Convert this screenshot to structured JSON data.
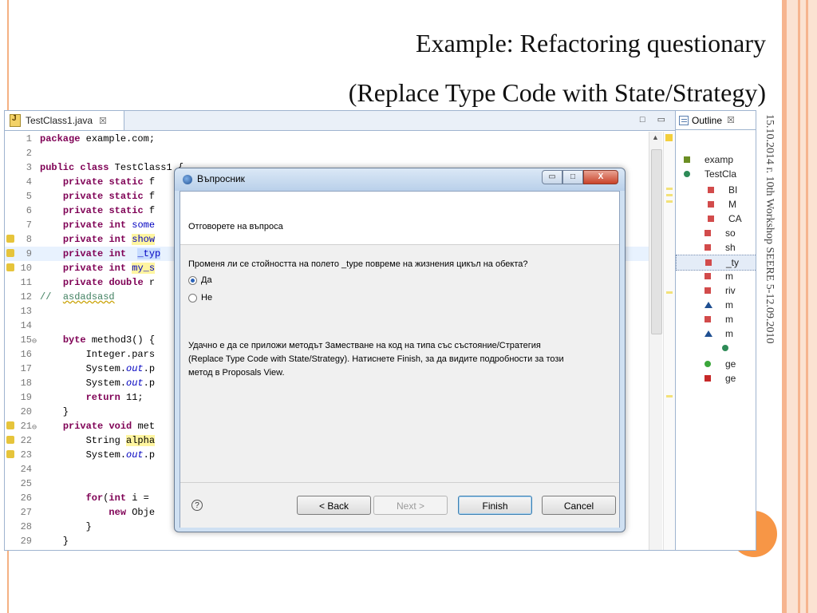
{
  "slide": {
    "title_line1": "Example: Refactoring questionary",
    "title_line2": "(Replace Type Code with State/Strategy)",
    "side_text_date": "15.10.2014 г.",
    "side_text_event": "10th Workshop SEERE 5-12.09.2010",
    "accent_color": "#f79646",
    "band_color": "#fbe2d2"
  },
  "editor": {
    "tab_label": "TestClass1.java",
    "tab_close": "☒",
    "window_controls": "□ ▭",
    "lines": [
      {
        "n": "1",
        "text": "package example.com;"
      },
      {
        "n": "2",
        "text": ""
      },
      {
        "n": "3",
        "text": "public class TestClass1 {"
      },
      {
        "n": "4",
        "text": "    private static f"
      },
      {
        "n": "5",
        "text": "    private static f"
      },
      {
        "n": "6",
        "text": "    private static f"
      },
      {
        "n": "7",
        "text": "    private int some"
      },
      {
        "n": "8",
        "text": "    private int show"
      },
      {
        "n": "9",
        "text": "    private int  _typ"
      },
      {
        "n": "10",
        "text": "    private int my_s"
      },
      {
        "n": "11",
        "text": "    private double r"
      },
      {
        "n": "12",
        "text": "//  asdadsasd"
      },
      {
        "n": "13",
        "text": ""
      },
      {
        "n": "14",
        "text": ""
      },
      {
        "n": "15",
        "text": "    byte method3() {"
      },
      {
        "n": "16",
        "text": "        Integer.pars"
      },
      {
        "n": "17",
        "text": "        System.out.p"
      },
      {
        "n": "18",
        "text": "        System.out.p"
      },
      {
        "n": "19",
        "text": "        return 11;"
      },
      {
        "n": "20",
        "text": "    }"
      },
      {
        "n": "21",
        "text": "    private void met"
      },
      {
        "n": "22",
        "text": "        String alpha"
      },
      {
        "n": "23",
        "text": "        System.out.p"
      },
      {
        "n": "24",
        "text": ""
      },
      {
        "n": "25",
        "text": ""
      },
      {
        "n": "26",
        "text": "        for(int i = "
      },
      {
        "n": "27",
        "text": "            new Obje"
      },
      {
        "n": "28",
        "text": "        }"
      },
      {
        "n": "29",
        "text": "    }"
      }
    ]
  },
  "outline": {
    "tab_label": "Outline",
    "tab_close": "☒",
    "items": [
      "examp",
      "TestCla",
      "BI",
      "M",
      "CA",
      "so",
      "sh",
      "_ty",
      "m",
      "riv",
      "m",
      "m",
      "m",
      "",
      "ge",
      "ge"
    ]
  },
  "dialog": {
    "title": "Въпросник",
    "header_text": "Отговорете на въпроса",
    "question": "Променя ли се стойността на полето _type повреме на жизнения цикъл на обекта?",
    "options": [
      {
        "label": "Да",
        "selected": true
      },
      {
        "label": "Не",
        "selected": false
      }
    ],
    "info_line1": "Удачно е да се приложи методът Заместване на код на типа със състояние/Стратегия",
    "info_line2": "(Replace Type Code with State/Strategy). Натиснете Finish, за да видите подробности за този",
    "info_line3": "метод в Proposals View.",
    "help_label": "?",
    "btn_back": "< Back",
    "btn_next": "Next >",
    "btn_finish": "Finish",
    "btn_cancel": "Cancel",
    "btn_min": "▭",
    "btn_max": "□",
    "btn_close": "X"
  }
}
